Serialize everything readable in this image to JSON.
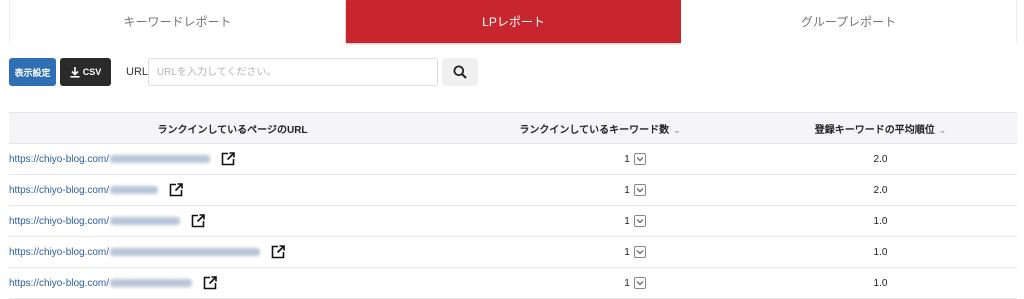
{
  "tabs": [
    {
      "label": "キーワードレポート",
      "active": false
    },
    {
      "label": "LPレポート",
      "active": true
    },
    {
      "label": "グループレポート",
      "active": false
    }
  ],
  "toolbar": {
    "settings_label": "表示設定",
    "csv_label": "CSV",
    "url_label": "URL",
    "url_placeholder": "URLを入力してください。",
    "url_value": ""
  },
  "table": {
    "headers": {
      "url": "ランクインしているページのURL",
      "count": "ランクインしているキーワード数",
      "avg": "登録キーワードの平均順位"
    },
    "rows": [
      {
        "url_prefix": "https://chiyo-blog.com/",
        "count": "1",
        "avg": "2.0"
      },
      {
        "url_prefix": "https://chiyo-blog.com/",
        "count": "1",
        "avg": "2.0"
      },
      {
        "url_prefix": "https://chiyo-blog.com/",
        "count": "1",
        "avg": "1.0"
      },
      {
        "url_prefix": "https://chiyo-blog.com/",
        "count": "1",
        "avg": "1.0"
      },
      {
        "url_prefix": "https://chiyo-blog.com/",
        "count": "1",
        "avg": "1.0"
      }
    ]
  },
  "colors": {
    "active_tab": "#c8262f",
    "settings_button": "#2f6fb3",
    "csv_button": "#2a2a2a",
    "link": "#2a5ea6"
  },
  "icons": {
    "csv": "download-icon",
    "search": "search-icon",
    "external": "external-link-icon",
    "sort": "chevron-down-icon",
    "row_toggle": "chevron-down-icon"
  }
}
